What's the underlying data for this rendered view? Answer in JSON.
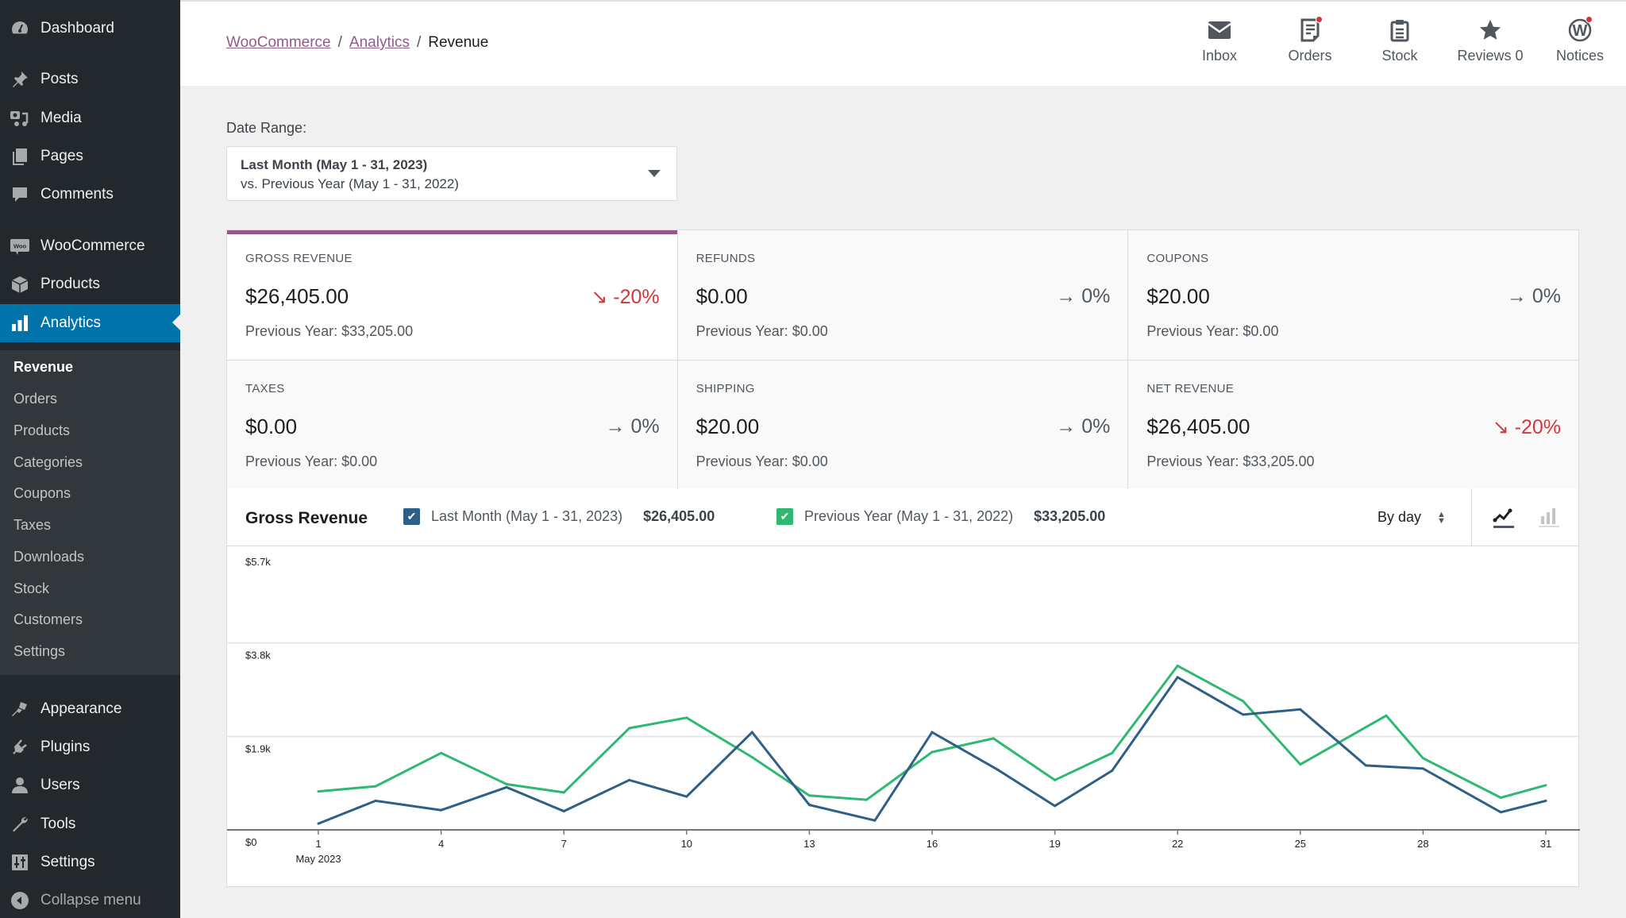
{
  "sidebar": {
    "items": [
      {
        "label": "Dashboard",
        "icon": "dashboard-icon"
      },
      {
        "label": "Posts",
        "icon": "pin-icon"
      },
      {
        "label": "Media",
        "icon": "media-icon"
      },
      {
        "label": "Pages",
        "icon": "pages-icon"
      },
      {
        "label": "Comments",
        "icon": "comment-icon"
      },
      {
        "label": "WooCommerce",
        "icon": "woo-icon"
      },
      {
        "label": "Products",
        "icon": "box-icon"
      },
      {
        "label": "Analytics",
        "icon": "bar-chart-icon",
        "active": true
      },
      {
        "label": "Appearance",
        "icon": "brush-icon"
      },
      {
        "label": "Plugins",
        "icon": "plug-icon"
      },
      {
        "label": "Users",
        "icon": "user-icon"
      },
      {
        "label": "Tools",
        "icon": "wrench-icon"
      },
      {
        "label": "Settings",
        "icon": "sliders-icon"
      },
      {
        "label": "Collapse menu",
        "icon": "collapse-icon"
      }
    ],
    "submenu": [
      "Revenue",
      "Orders",
      "Products",
      "Categories",
      "Coupons",
      "Taxes",
      "Downloads",
      "Stock",
      "Customers",
      "Settings"
    ],
    "submenu_current": "Revenue"
  },
  "header": {
    "breadcrumb": [
      {
        "label": "WooCommerce",
        "link": true
      },
      {
        "label": "Analytics",
        "link": true
      },
      {
        "label": "Revenue",
        "link": false
      }
    ],
    "separator": "/",
    "activity": [
      {
        "label": "Inbox",
        "icon": "inbox-icon",
        "badge": false
      },
      {
        "label": "Orders",
        "icon": "orders-icon",
        "badge": true
      },
      {
        "label": "Stock",
        "icon": "clipboard-icon",
        "badge": false
      },
      {
        "label": "Reviews 0",
        "icon": "star-icon",
        "badge": false
      },
      {
        "label": "Notices",
        "icon": "wordpress-icon",
        "badge": true
      }
    ]
  },
  "date_range": {
    "label": "Date Range:",
    "primary": "Last Month (May 1 - 31, 2023)",
    "compare": "vs. Previous Year (May 1 - 31, 2022)"
  },
  "summary": [
    {
      "title": "GROSS REVENUE",
      "value": "$26,405.00",
      "delta": "-20%",
      "direction": "down",
      "prev": "Previous Year: $33,205.00",
      "selected": true
    },
    {
      "title": "REFUNDS",
      "value": "$0.00",
      "delta": "0%",
      "direction": "flat",
      "prev": "Previous Year: $0.00"
    },
    {
      "title": "COUPONS",
      "value": "$20.00",
      "delta": "0%",
      "direction": "flat",
      "prev": "Previous Year: $0.00"
    },
    {
      "title": "TAXES",
      "value": "$0.00",
      "delta": "0%",
      "direction": "flat",
      "prev": "Previous Year: $0.00"
    },
    {
      "title": "SHIPPING",
      "value": "$20.00",
      "delta": "0%",
      "direction": "flat",
      "prev": "Previous Year: $0.00"
    },
    {
      "title": "NET REVENUE",
      "value": "$26,405.00",
      "delta": "-20%",
      "direction": "down",
      "prev": "Previous Year: $33,205.00"
    }
  ],
  "chart_panel": {
    "title": "Gross Revenue",
    "legend": [
      {
        "label": "Last Month (May 1 - 31, 2023)",
        "total": "$26,405.00",
        "color": "#2d5f87",
        "checked": true
      },
      {
        "label": "Previous Year (May 1 - 31, 2022)",
        "total": "$33,205.00",
        "color": "#2eb872",
        "checked": true
      }
    ],
    "interval": "By day",
    "chart_types": [
      "line-chart-icon",
      "bar-chart-icon"
    ],
    "selected_type": "line"
  },
  "colors": {
    "accent": "#0073aa",
    "woo_purple": "#96588a",
    "negative": "#d63638",
    "series_current": "#2d5f87",
    "series_previous": "#2eb872"
  },
  "chart_data": {
    "type": "line",
    "title": "Gross Revenue",
    "xlabel": "May 2023",
    "ylabel": "",
    "x_ticks": [
      1,
      4,
      7,
      10,
      13,
      16,
      19,
      22,
      25,
      28,
      31
    ],
    "x_range": [
      1,
      31
    ],
    "y_ticks": [
      "$0",
      "$1.9k",
      "$3.8k",
      "$5.7k"
    ],
    "y_tick_values": [
      0,
      1900,
      3800,
      5700
    ],
    "ylim": [
      0,
      5700
    ],
    "grid": true,
    "series": [
      {
        "name": "Last Month (May 1 - 31, 2023)",
        "color": "#2d5f87",
        "x": [
          1,
          2.4,
          4,
          5.6,
          7,
          8.6,
          10,
          11.6,
          13,
          14.6,
          16,
          17.6,
          19,
          20.4,
          22,
          23.6,
          25,
          26.6,
          28,
          29.9,
          31
        ],
        "values": [
          127,
          591,
          401,
          866,
          380,
          1013,
          676,
          1984,
          507,
          190,
          1984,
          1224,
          486,
          1203,
          3103,
          2343,
          2449,
          1309,
          1246,
          359,
          591
        ]
      },
      {
        "name": "Previous Year (May 1 - 31, 2022)",
        "color": "#2eb872",
        "x": [
          1,
          2.4,
          4,
          5.6,
          7,
          8.6,
          10,
          11.6,
          13,
          14.4,
          16,
          17.5,
          19,
          20.4,
          22,
          23.6,
          25,
          27.1,
          28,
          29.9,
          31
        ],
        "values": [
          781,
          887,
          1562,
          929,
          760,
          2069,
          2280,
          1478,
          697,
          612,
          1583,
          1858,
          1013,
          1562,
          3336,
          2618,
          1330,
          2322,
          1457,
          654,
          908
        ]
      }
    ]
  }
}
